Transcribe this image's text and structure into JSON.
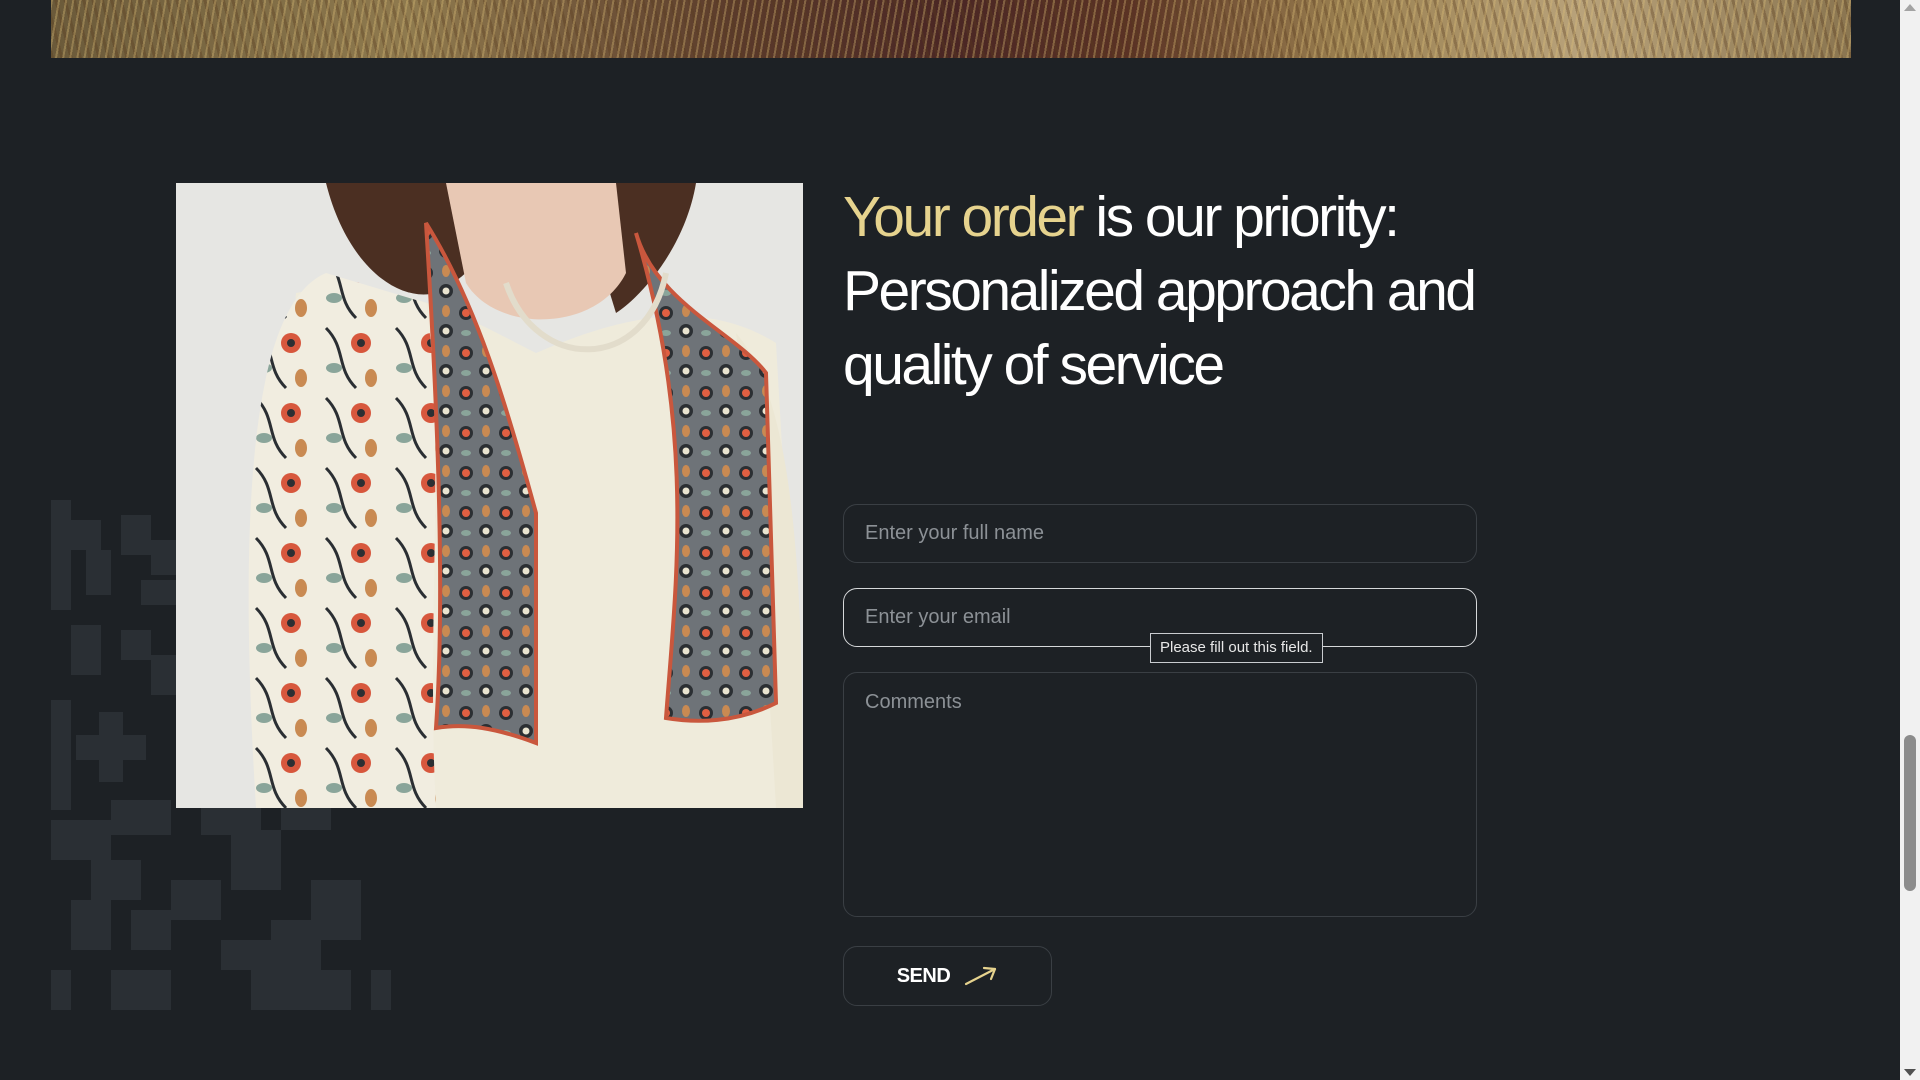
{
  "heading": {
    "accent": "Your order",
    "rest": " is our priority: Personalized approach and quality of service"
  },
  "form": {
    "name_placeholder": "Enter your full name",
    "email_placeholder": "Enter your email",
    "comments_placeholder": "Comments",
    "validation_tooltip": "Please fill out this field.",
    "send_label": "SEND"
  },
  "colors": {
    "background": "#1d2125",
    "accent": "#e6d38e",
    "text": "#ffffff",
    "field_border": "#3a3f44",
    "placeholder": "#8c9196"
  },
  "icons": {
    "send": "arrow-up-right-icon"
  }
}
